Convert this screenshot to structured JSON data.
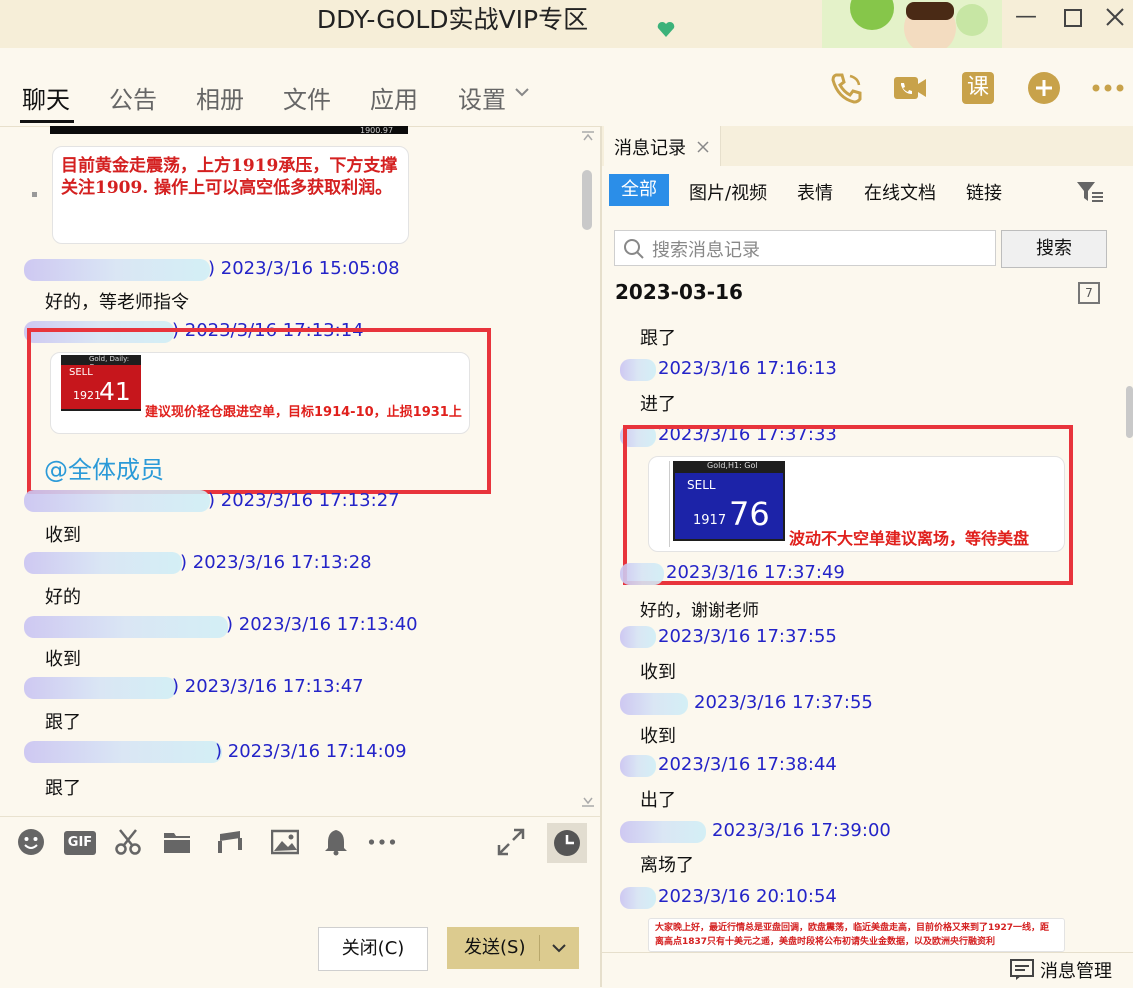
{
  "window": {
    "title": "DDY-GOLD实战VIP专区"
  },
  "nav": {
    "tabs": [
      "聊天",
      "公告",
      "相册",
      "文件",
      "应用",
      "设置"
    ],
    "settings_chevron": "chevron-down-icon",
    "tools": [
      "phone-call-icon",
      "video-call-icon",
      "class-icon",
      "add-icon",
      "more-icon"
    ],
    "class_label": "课"
  },
  "left_chat": {
    "first_card_text": "目前黄金走震荡，上方1919承压，下方支撑关注1909. 操作上可以高空低多获取利润。",
    "chart_price_label": "1900.97",
    "messages": [
      {
        "time": ") 2023/3/16 15:05:08",
        "text": "好的，等老师指令"
      },
      {
        "time": ") 2023/3/16 17:13:14",
        "text": ""
      },
      {
        "time": ") 2023/3/16 17:13:27",
        "text": "收到"
      },
      {
        "time": ") 2023/3/16 17:13:28",
        "text": "好的"
      },
      {
        "time": ") 2023/3/16 17:13:40",
        "text": "收到"
      },
      {
        "time": ") 2023/3/16 17:13:47",
        "text": "跟了"
      },
      {
        "time": ") 2023/3/16 17:14:09",
        "text": "跟了"
      }
    ],
    "trade_card": {
      "header": "Gold, Daily: Go",
      "sell": "SELL",
      "price_small": "1921",
      "price_big": "41",
      "advice": "建议现价轻仓跟进空单，目标1914-10，止损1931上"
    },
    "mention": "@全体成员"
  },
  "input_tools": [
    "emoji-icon",
    "gif-icon",
    "scissors-icon",
    "folder-icon",
    "music-icon",
    "image-icon",
    "bell-icon",
    "more-icon",
    "expand-icon",
    "history-icon"
  ],
  "input_tools_labels": {
    "gif": "GIF"
  },
  "buttons": {
    "close": "关闭(C)",
    "send": "发送(S)"
  },
  "right_panel": {
    "tab_title": "消息记录",
    "filters": [
      "全部",
      "图片/视频",
      "表情",
      "在线文档",
      "链接"
    ],
    "search_placeholder": "搜索消息记录",
    "search_button": "搜索",
    "date": "2023-03-16",
    "calendar_day": "7",
    "records": [
      {
        "text": "跟了",
        "time": "2023/3/16 17:16:13"
      },
      {
        "text": "进了",
        "time": "2023/3/16 17:37:33"
      },
      {
        "text": "",
        "time": "2023/3/16 17:37:49"
      },
      {
        "text": "好的，谢谢老师",
        "time": "2023/3/16 17:37:55"
      },
      {
        "text": "收到",
        "time": "2023/3/16 17:37:55"
      },
      {
        "text": "收到",
        "time": "2023/3/16 17:38:44"
      },
      {
        "text": "出了",
        "time": "2023/3/16 17:39:00"
      },
      {
        "text": "离场了",
        "time": "2023/3/16 20:10:54"
      }
    ],
    "trade_card": {
      "header": "Gold,H1: Gol",
      "sell": "SELL",
      "price_small": "1917",
      "price_big": "76",
      "advice": "波动不大空单建议离场，等待美盘"
    },
    "notice_text": "大家晚上好，最近行情总是亚盘回调，欧盘震荡，临近美盘走高，目前价格又来到了1927一线，距离高点1837只有十美元之遥，美盘时段将公布初请失业金数据，以及欧洲央行融资利",
    "footer": "消息管理"
  },
  "colors": {
    "accent": "#2b8ee8",
    "name": "#2424c8",
    "highlight": "#e8343c",
    "icon_gold": "#c8a24a"
  }
}
